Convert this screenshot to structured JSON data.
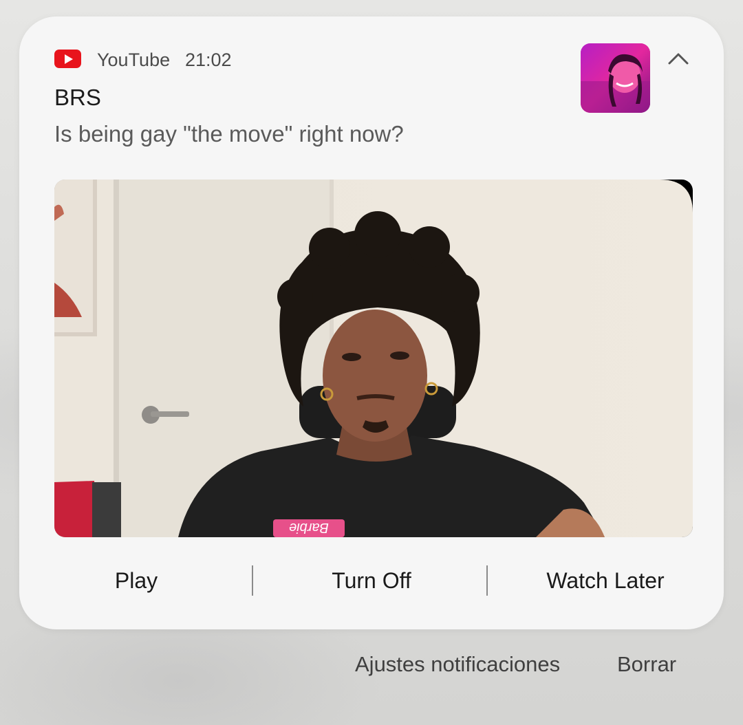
{
  "notification": {
    "app_name": "YouTube",
    "time": "21:02",
    "title": "BRS",
    "message": "Is being gay \"the move\" right now?",
    "actions": {
      "play": "Play",
      "turn_off": "Turn Off",
      "watch_later": "Watch Later"
    }
  },
  "footer": {
    "settings": "Ajustes notificaciones",
    "clear": "Borrar"
  },
  "colors": {
    "youtube_red": "#e8141c",
    "thumbnail_accent": "#d42ab8"
  },
  "icons": {
    "app": "youtube-logo-icon",
    "expand": "chevron-up-icon"
  }
}
